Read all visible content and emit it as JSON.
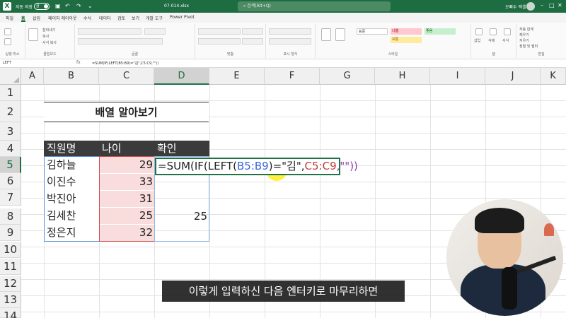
{
  "titlebar": {
    "autosave_label": "자동 저장",
    "autosave_state": "끔",
    "filename": "07-014.xlsx",
    "search_placeholder": "검색(Alt+Q)",
    "user_name": "오빠두 엑셀"
  },
  "menu": {
    "tabs": [
      "파일",
      "홈",
      "삽입",
      "페이지 레이아웃",
      "수식",
      "데이터",
      "검토",
      "보기",
      "개발 도구",
      "Power Pivot"
    ],
    "active": "홈"
  },
  "ribbon": {
    "groups": [
      "실행 취소",
      "클립보드",
      "글꼴",
      "맞춤",
      "표시 형식",
      "스타일",
      "셀",
      "편집"
    ],
    "clipboard_items": [
      "잘라내기",
      "복사",
      "서식 복사"
    ],
    "style_cells": [
      "표준",
      "나쁨",
      "보통",
      "좋음"
    ],
    "cells_items": [
      "삽입",
      "삭제",
      "서식"
    ],
    "edit_items": [
      "자동 합계",
      "채우기",
      "지우기",
      "정렬 및 필터"
    ]
  },
  "formula_bar": {
    "namebox": "LEFT",
    "fx": "fx",
    "text": "=SUM(IF(LEFT(B5:B9)=\"김\",C5:C9,\"\"))"
  },
  "grid": {
    "columns": [
      "A",
      "B",
      "C",
      "D",
      "E",
      "F",
      "G",
      "H",
      "I",
      "J",
      "K"
    ],
    "rows": [
      "1",
      "2",
      "3",
      "4",
      "5",
      "6",
      "7",
      "8",
      "9",
      "10",
      "11",
      "12",
      "13",
      "14"
    ],
    "title": "배열 알아보기",
    "header": {
      "name": "직원명",
      "age": "나이",
      "check": "확인"
    },
    "names": [
      "김하늘",
      "이진수",
      "박진아",
      "김세찬",
      "정은지"
    ],
    "ages": [
      "29",
      "33",
      "31",
      "25",
      "32"
    ],
    "d8_value": "25",
    "formula_parts": {
      "p1": "=SUM(IF(LEFT(",
      "p2": "B5:B9",
      "p3": ")=\"",
      "p4": "김",
      "p5": "\",",
      "p6": "C5:C9",
      "p7": ",\"\"))"
    }
  },
  "subtitle": "이렇게 입력하신 다음 엔터키로 마무리하면",
  "colors": {
    "excel_green": "#1e6c41",
    "header_dark": "#3b3b3b",
    "age_fill": "#f9dcdc",
    "name_border": "#5b8fd6",
    "age_border": "#d14b4b",
    "cursor_highlight": "#ffeb00"
  }
}
